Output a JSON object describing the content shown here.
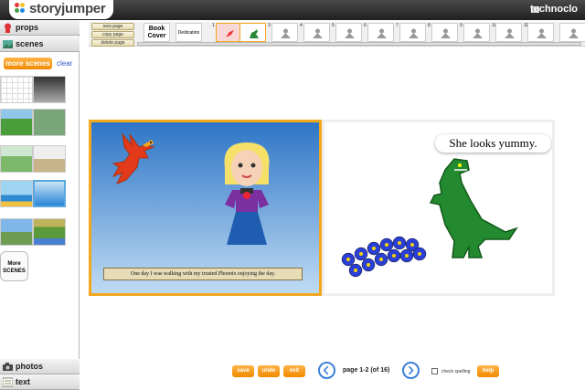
{
  "app": {
    "logo_text": "storyjumper",
    "username": "technoclo"
  },
  "sidebar": {
    "props_label": "props",
    "scenes_label": "scenes",
    "more_scenes_label": "more scenes",
    "clear_label": "clear",
    "more_label_1": "More",
    "more_label_2": "SCENES",
    "photos_label": "photos",
    "text_label": "text"
  },
  "filmstrip": {
    "new_page": "new page",
    "copy_page": "copy page",
    "delete_page": "delete page",
    "book_cover": "Book Cover",
    "dedication": "Dedication",
    "page_numbers": [
      "1",
      "2",
      "3",
      "4",
      "5",
      "6",
      "7",
      "8",
      "9",
      "10",
      "11"
    ]
  },
  "book": {
    "caption": "One day I was walking with my trusted Phoenix enjoying the day.",
    "speech": "She looks yummy."
  },
  "bottom": {
    "save": "save",
    "undo": "undo",
    "exit": "exit",
    "page_info": "page 1-2 (of 16)",
    "check_spelling": "check spelling",
    "help": "help"
  },
  "colors": {
    "accent_orange": "#f08a00",
    "frame_orange": "#f2a71c",
    "nav_blue": "#3b7fd9"
  }
}
